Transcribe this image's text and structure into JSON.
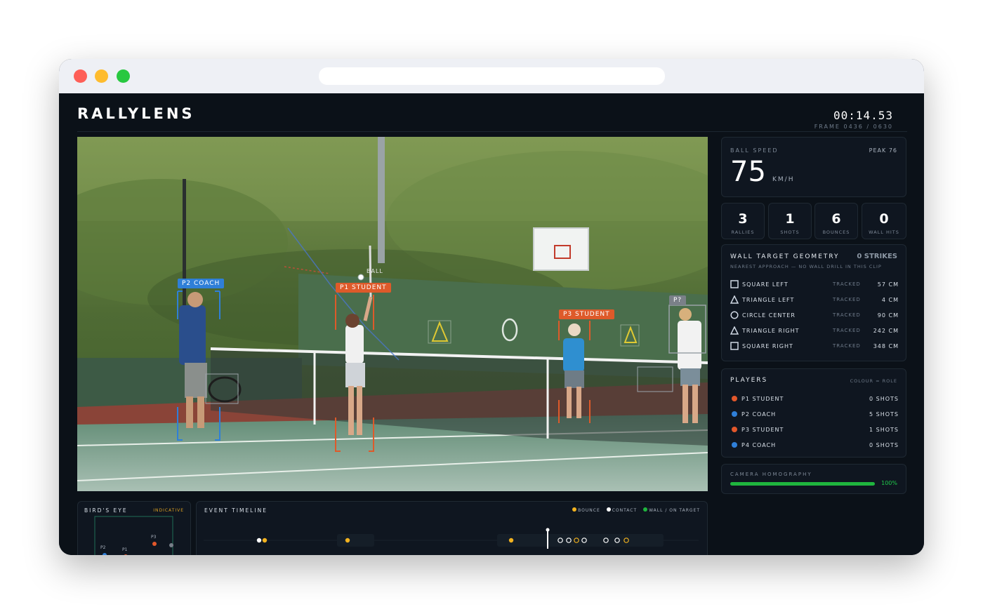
{
  "app": {
    "title": "RALLYLENS",
    "clock": "00:14.53",
    "frame": "FRAME 0436 / 0630"
  },
  "video": {
    "labels": {
      "p2": "P2 COACH",
      "p1": "P1 STUDENT",
      "p3": "P3 STUDENT",
      "p4": "P?",
      "ball": "BALL"
    }
  },
  "speed": {
    "label": "BALL SPEED",
    "peak": "PEAK 76",
    "value": "75",
    "unit": "KM/H"
  },
  "stats": [
    {
      "value": "3",
      "label": "RALLIES"
    },
    {
      "value": "1",
      "label": "SHOTS"
    },
    {
      "value": "6",
      "label": "BOUNCES"
    },
    {
      "value": "0",
      "label": "WALL HITS"
    }
  ],
  "wall": {
    "title": "WALL TARGET GEOMETRY",
    "strikes": "0 STRIKES",
    "subtitle": "NEAREST APPROACH — NO WALL DRILL IN THIS CLIP",
    "rows": [
      {
        "icon": "square-icon",
        "name": "SQUARE LEFT",
        "status": "TRACKED",
        "dist": "57 CM"
      },
      {
        "icon": "triangle-icon",
        "name": "TRIANGLE LEFT",
        "status": "TRACKED",
        "dist": "4 CM"
      },
      {
        "icon": "circle-icon",
        "name": "CIRCLE CENTER",
        "status": "TRACKED",
        "dist": "90 CM"
      },
      {
        "icon": "triangle-icon",
        "name": "TRIANGLE RIGHT",
        "status": "TRACKED",
        "dist": "242 CM"
      },
      {
        "icon": "square-icon",
        "name": "SQUARE RIGHT",
        "status": "TRACKED",
        "dist": "348 CM"
      }
    ]
  },
  "players": {
    "title": "PLAYERS",
    "legend": "COLOUR = ROLE",
    "rows": [
      {
        "name": "P1 STUDENT",
        "shots": "0 SHOTS",
        "color": "#e2572b"
      },
      {
        "name": "P2 COACH",
        "shots": "5 SHOTS",
        "color": "#2f7fd8"
      },
      {
        "name": "P3 STUDENT",
        "shots": "1 SHOTS",
        "color": "#e2572b"
      },
      {
        "name": "P4 COACH",
        "shots": "0 SHOTS",
        "color": "#2f7fd8"
      }
    ]
  },
  "homography": {
    "label": "CAMERA HOMOGRAPHY",
    "percent": "100%",
    "fraction": 1.0
  },
  "birdseye": {
    "label": "BIRD'S EYE",
    "badge": "INDICATIVE",
    "markers": [
      "P2",
      "P1",
      "P3"
    ]
  },
  "timeline": {
    "label": "EVENT TIMELINE",
    "legend": {
      "bounce": "BOUNCE",
      "contact": "CONTACT",
      "wall": "WALL / ON TARGET"
    }
  },
  "colors": {
    "accent_orange": "#e2572b",
    "accent_blue": "#2f7fd8",
    "bounce": "#f2b21f",
    "wall": "#1fb53e",
    "contact": "#ffffff"
  }
}
